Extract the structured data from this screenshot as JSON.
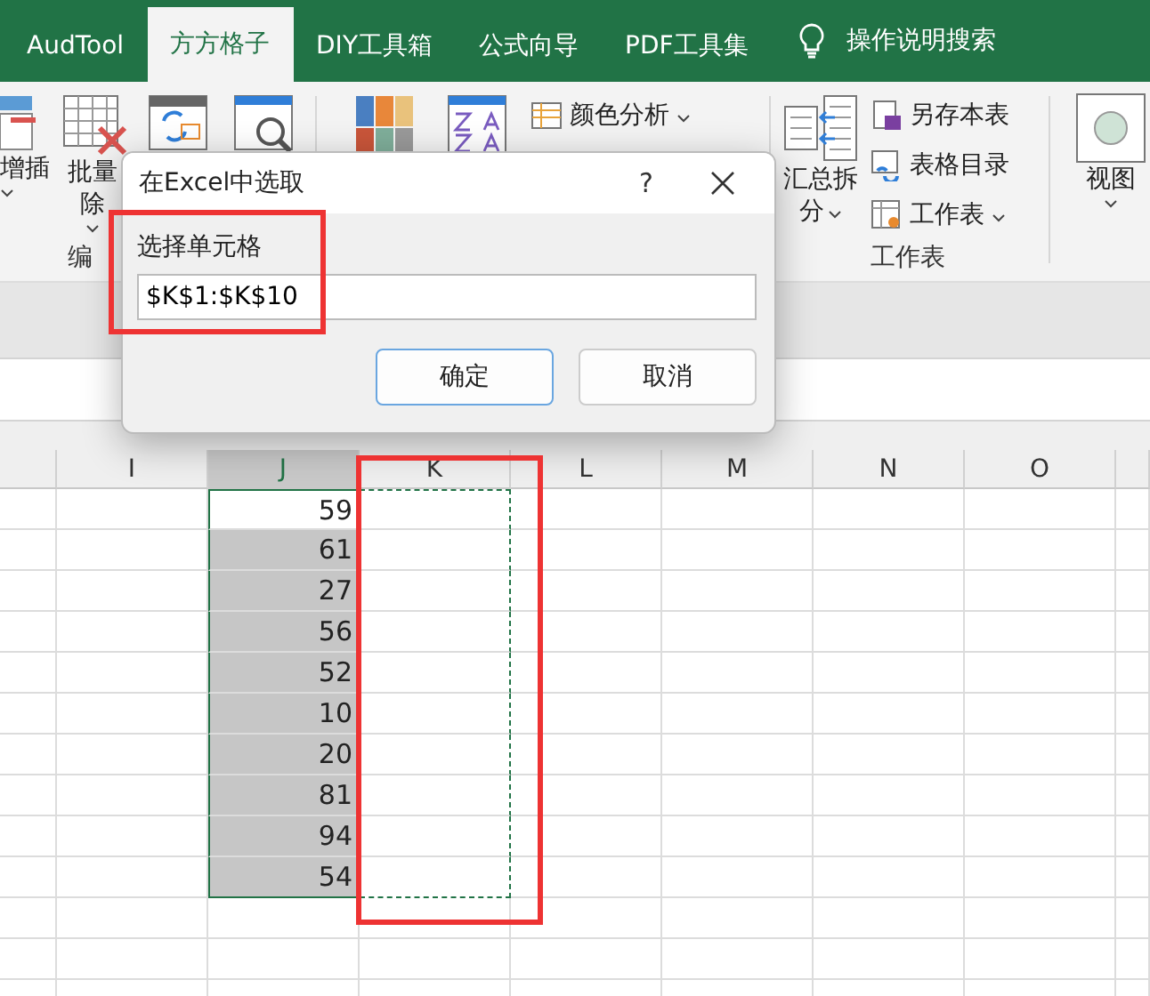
{
  "tabs": [
    {
      "label": "AudTool",
      "selected": false
    },
    {
      "label": "方方格子",
      "selected": true
    },
    {
      "label": "DIY工具箱",
      "selected": false
    },
    {
      "label": "公式向导",
      "selected": false
    },
    {
      "label": "PDF工具集",
      "selected": false
    }
  ],
  "search": {
    "label": "操作说明搜索"
  },
  "ribbon": {
    "edit_group": {
      "buttons": [
        {
          "label": "增插",
          "dropdown": true
        },
        {
          "label": "批量",
          "sublabel": "除",
          "dropdown": true
        }
      ],
      "group_label": "编"
    },
    "analysis_items": [
      {
        "label": "颜色分析",
        "dropdown": true
      }
    ],
    "sheet_group": {
      "large_button": {
        "label": "汇总拆",
        "sublabel": "分",
        "dropdown": true
      },
      "small_buttons": [
        {
          "label": "另存本表",
          "dropdown": false
        },
        {
          "label": "表格目录",
          "dropdown": false
        },
        {
          "label": "工作表",
          "dropdown": true
        }
      ],
      "group_label": "工作表"
    },
    "view_button": {
      "label": "视图",
      "dropdown": true
    }
  },
  "dialog": {
    "title": "在Excel中选取",
    "help": "?",
    "field_label": "选择单元格",
    "value": "$K$1:$K$10",
    "buttons": [
      {
        "label": "确定",
        "selected": true
      },
      {
        "label": "取消",
        "selected": false
      }
    ]
  },
  "sheet": {
    "columns": [
      {
        "label": "I",
        "selected": false,
        "marquee": false
      },
      {
        "label": "J",
        "selected": true,
        "marquee": false
      },
      {
        "label": "K",
        "selected": false,
        "marquee": true
      },
      {
        "label": "L",
        "selected": false,
        "marquee": false
      },
      {
        "label": "M",
        "selected": false,
        "marquee": false
      },
      {
        "label": "N",
        "selected": false,
        "marquee": false
      },
      {
        "label": "O",
        "selected": false,
        "marquee": false
      }
    ],
    "values": [
      "59",
      "61",
      "27",
      "56",
      "52",
      "10",
      "20",
      "81",
      "94",
      "54"
    ]
  },
  "annotations": [
    {
      "kind": "rectangle",
      "color": "#ee3333"
    },
    {
      "kind": "rectangle",
      "color": "#ee3333"
    }
  ]
}
